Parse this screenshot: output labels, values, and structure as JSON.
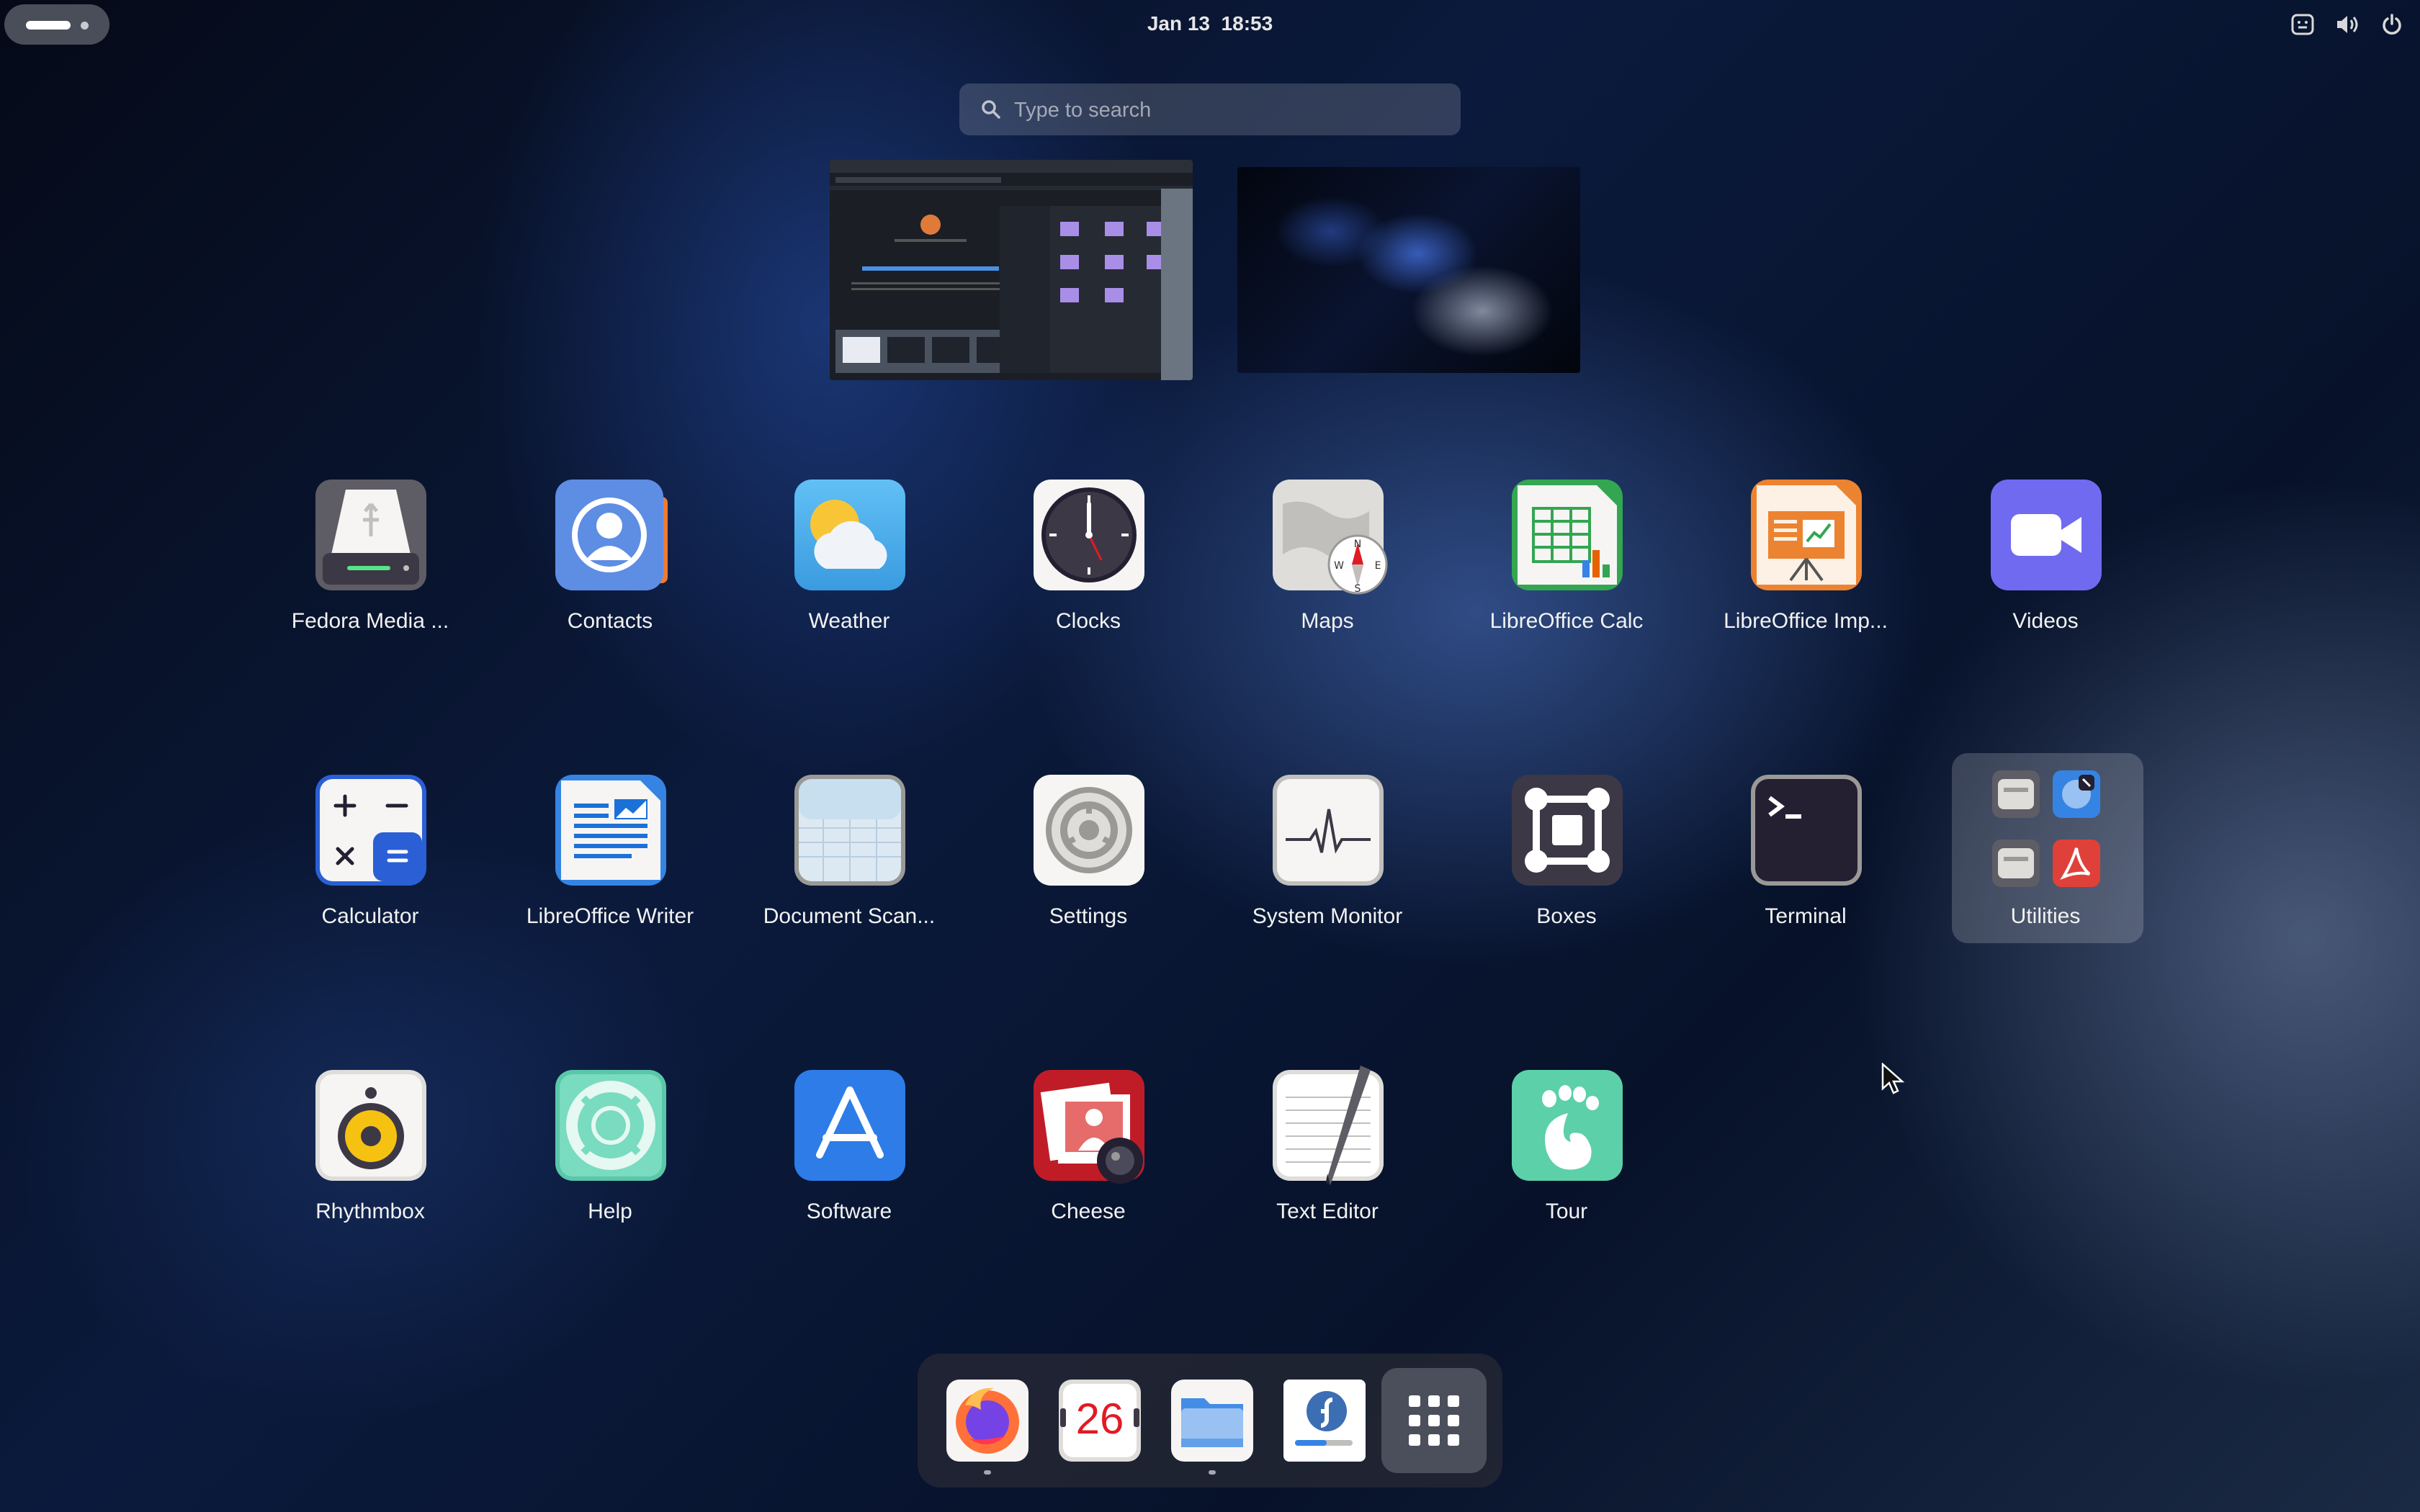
{
  "topbar": {
    "activities_label": "Activities",
    "date": "Jan 13",
    "time": "18:53",
    "tray_icons": [
      "accessibility-icon",
      "volume-icon",
      "power-icon"
    ]
  },
  "search": {
    "placeholder": "Type to search"
  },
  "workspaces": [
    {
      "name": "workspace-1",
      "kind": "desktop-with-windows"
    },
    {
      "name": "workspace-2",
      "kind": "empty-wallpaper"
    }
  ],
  "apps": {
    "fedora_media_writer": "Fedora Media ...",
    "contacts": "Contacts",
    "weather": "Weather",
    "clocks": "Clocks",
    "maps": "Maps",
    "libreoffice_calc": "LibreOffice Calc",
    "libreoffice_impress": "LibreOffice Imp...",
    "videos": "Videos",
    "calculator": "Calculator",
    "libreoffice_writer": "LibreOffice Writer",
    "document_scanner": "Document Scan...",
    "settings": "Settings",
    "system_monitor": "System Monitor",
    "boxes": "Boxes",
    "terminal": "Terminal",
    "utilities": "Utilities",
    "rhythmbox": "Rhythmbox",
    "help": "Help",
    "software": "Software",
    "cheese": "Cheese",
    "text_editor": "Text Editor",
    "tour": "Tour"
  },
  "dock": {
    "calendar_day": "26",
    "items": [
      "Firefox",
      "Calendar",
      "Files",
      "Fedora Welcome",
      "Show Apps"
    ]
  },
  "colors": {
    "accent": "#3584e4",
    "panel_text": "#e6e6e6"
  }
}
